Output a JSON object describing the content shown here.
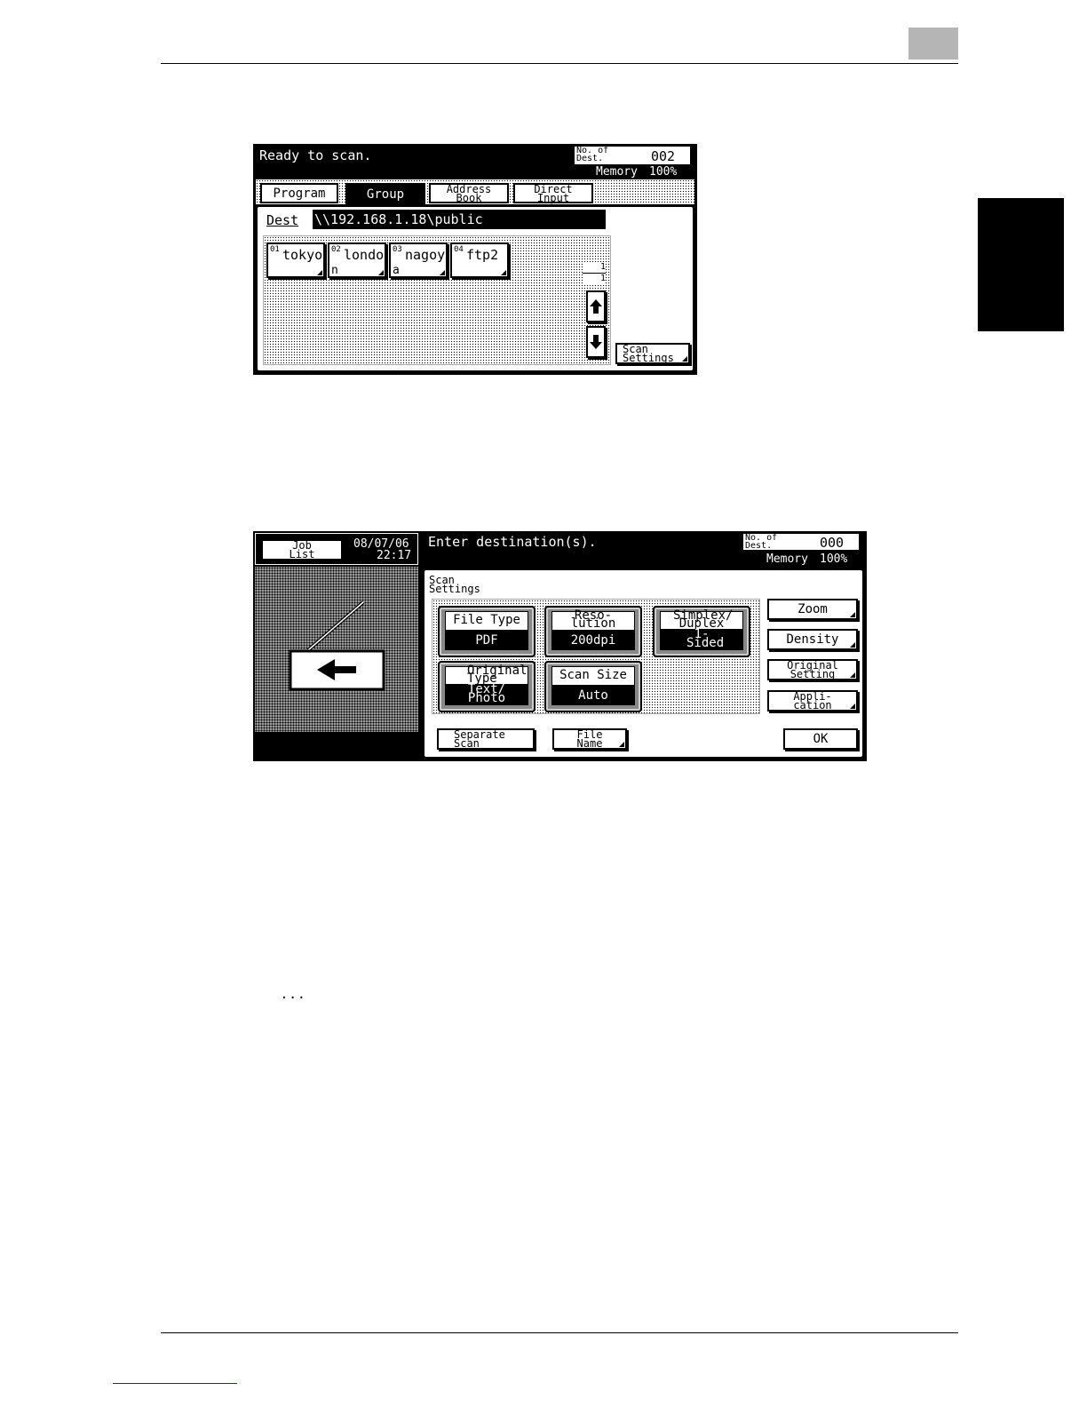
{
  "page": {
    "chapter_box": ""
  },
  "screen1": {
    "status": "Ready to scan.",
    "no_of_dest_label": "No. of Dest.",
    "no_of_dest_value": "002",
    "memory_label": "Memory",
    "memory_value": "100%",
    "tabs": [
      {
        "label": "Program"
      },
      {
        "label": "Group"
      },
      {
        "label": "Address Book"
      },
      {
        "label": "Direct Input"
      }
    ],
    "dest_label": "Dest",
    "dest_value": "\\\\192.168.1.18\\public",
    "destinations": [
      {
        "num": "01",
        "line1": "tokyo",
        "line2": ""
      },
      {
        "num": "02",
        "line1": "londo",
        "line2": "n"
      },
      {
        "num": "03",
        "line1": "nagoy",
        "line2": "a"
      },
      {
        "num": "04",
        "line1": "ftp2",
        "line2": ""
      }
    ],
    "page_current": "1",
    "page_total": "1",
    "scan_settings_label": "Scan Settings"
  },
  "screen2": {
    "job_list_label": "Job List",
    "date": "08/07/06",
    "time": "22:17",
    "status": "Enter destination(s).",
    "no_of_dest_label": "No. of Dest.",
    "no_of_dest_value": "000",
    "memory_label": "Memory",
    "memory_value": "100%",
    "panel_title": "Scan Settings",
    "settings": [
      {
        "label": "File Type",
        "value": "PDF"
      },
      {
        "label": "Reso- lution",
        "value": "200dpi"
      },
      {
        "label": "Simplex/ Duplex",
        "value": "1- Sided"
      },
      {
        "label": "Original Type",
        "value": "Text/ Photo"
      },
      {
        "label": "Scan Size",
        "value": "Auto"
      }
    ],
    "side_buttons": [
      {
        "label": "Zoom"
      },
      {
        "label": "Density"
      },
      {
        "label": "Original Setting"
      },
      {
        "label": "Appli- cation"
      }
    ],
    "separate_scan_label": "Separate Scan",
    "file_name_label": "File Name",
    "ok_label": "OK"
  },
  "note_ellipsis": "..."
}
